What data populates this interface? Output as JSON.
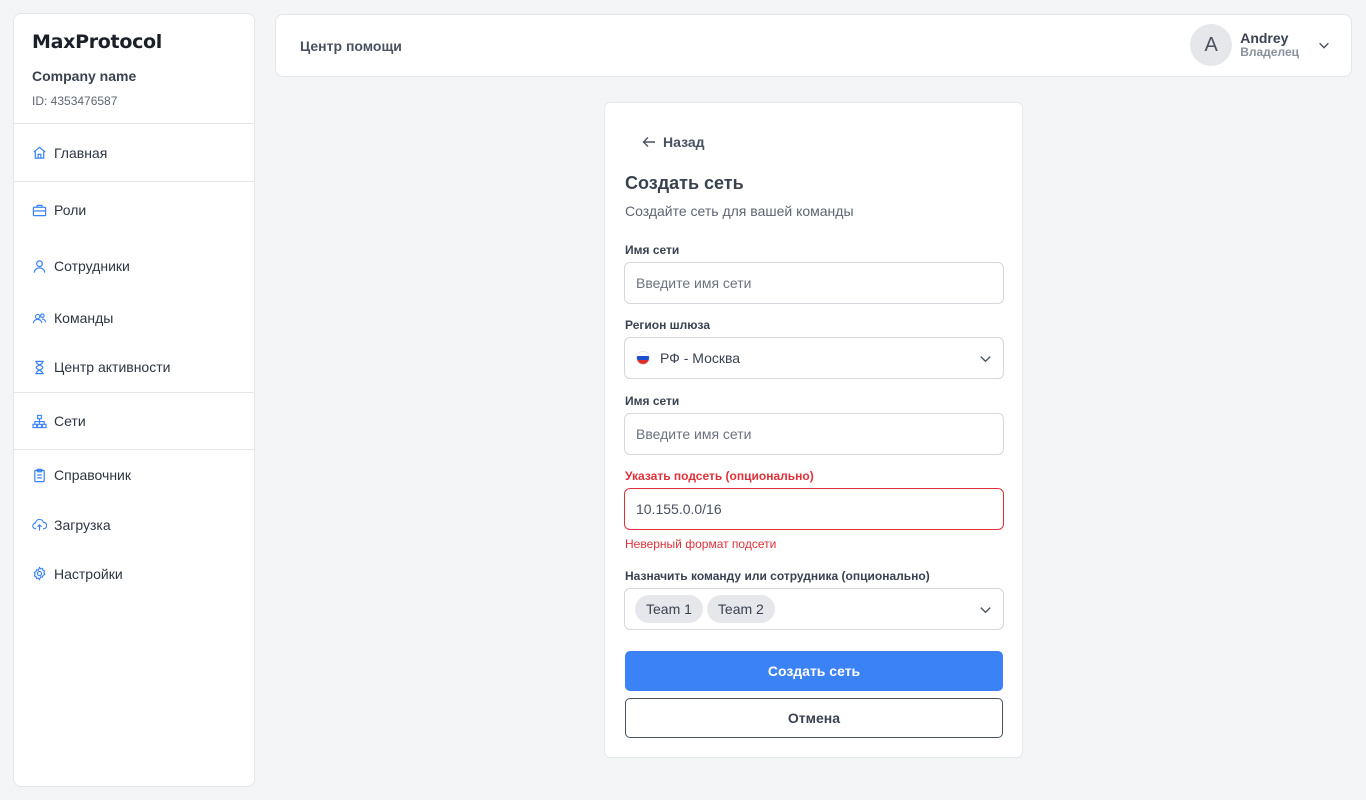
{
  "app": {
    "logo_text": "MaxProtocol",
    "company_name": "Company name",
    "company_id": "ID: 4353476587"
  },
  "sidebar": {
    "items": [
      {
        "label": "Главная",
        "icon": "home-icon"
      },
      {
        "label": "Роли",
        "icon": "briefcase-icon"
      },
      {
        "label": "Сотрудники",
        "icon": "user-icon"
      },
      {
        "label": "Команды",
        "icon": "users-icon"
      },
      {
        "label": "Центр активности",
        "icon": "hourglass-icon"
      },
      {
        "label": "Сети",
        "icon": "network-icon"
      },
      {
        "label": "Справочник",
        "icon": "clipboard-icon"
      },
      {
        "label": "Загрузка",
        "icon": "cloud-upload-icon"
      },
      {
        "label": "Настройки",
        "icon": "gear-icon"
      }
    ]
  },
  "header": {
    "help_center": "Центр помощи",
    "user": {
      "initial": "A",
      "name": "Andrey",
      "role": "Владелец"
    }
  },
  "form": {
    "back_label": "Назад",
    "title": "Создать сеть",
    "subtitle": "Создайте сеть для вашей команды",
    "network_name": {
      "label": "Имя сети",
      "placeholder": "Введите имя сети",
      "value": ""
    },
    "gateway_region": {
      "label": "Регион шлюза",
      "value": "РФ - Москва",
      "flag": "russia-flag-icon"
    },
    "network_name_2": {
      "label": "Имя сети",
      "placeholder": "Введите имя сети",
      "value": ""
    },
    "subnet": {
      "label": "Указать подсеть (опционально)",
      "value": "10.155.0.0/16",
      "error": "Неверный формат подсети"
    },
    "assign": {
      "label": "Назначить команду или сотрудника (опционально)",
      "chips": [
        "Team 1",
        "Team 2"
      ]
    },
    "submit_label": "Создать сеть",
    "cancel_label": "Отмена"
  },
  "colors": {
    "accent": "#3b82f6",
    "error": "#e0313a",
    "background": "#f4f5f7"
  }
}
